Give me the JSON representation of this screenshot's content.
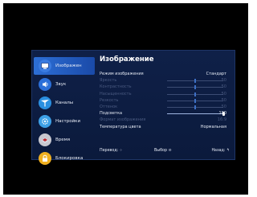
{
  "sidebar": {
    "items": [
      {
        "label": "Изображен",
        "icon": "picture-icon",
        "color": "#3a7be0",
        "active": true
      },
      {
        "label": "Звук",
        "icon": "sound-icon",
        "color": "#2b6fd8",
        "active": false
      },
      {
        "label": "Каналы",
        "icon": "antenna-icon",
        "color": "#2a8fe0",
        "active": false
      },
      {
        "label": "Настройки",
        "icon": "settings-icon",
        "color": "#3da0e6",
        "active": false
      },
      {
        "label": "Время",
        "icon": "clock-icon",
        "color": "#c8c8d0",
        "active": false
      },
      {
        "label": "Блокировка",
        "icon": "lock-icon",
        "color": "#f0b020",
        "active": false
      }
    ]
  },
  "panel": {
    "title": "Изображение",
    "rows": [
      {
        "label": "Режим изображения",
        "value": "Стандарт",
        "enabled": true,
        "slider": null
      },
      {
        "label": "Яркость",
        "value": "50",
        "enabled": false,
        "slider": 0.5
      },
      {
        "label": "Контрастность",
        "value": "50",
        "enabled": false,
        "slider": 0.5
      },
      {
        "label": "Насыщенность",
        "value": "50",
        "enabled": false,
        "slider": 0.5
      },
      {
        "label": "Резкость",
        "value": "50",
        "enabled": false,
        "slider": 0.5
      },
      {
        "label": "Оттенок",
        "value": "50",
        "enabled": false,
        "slider": 0.5
      },
      {
        "label": "Подсветка",
        "value": "100",
        "enabled": true,
        "slider": 1.0
      },
      {
        "label": "Формат изображения",
        "value": "16:9",
        "enabled": false,
        "slider": null
      },
      {
        "label": "Температура цвета",
        "value": "Нормальная",
        "enabled": true,
        "slider": null
      }
    ]
  },
  "footer": {
    "move_label": "Перевод",
    "select_label": "Выбор",
    "back_label": "Назад"
  }
}
